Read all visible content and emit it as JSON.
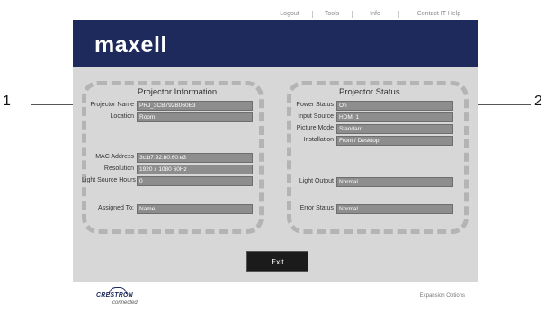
{
  "nav": {
    "logout": "Logout",
    "tools": "Tools",
    "info": "Info",
    "contact": "Contact IT Help"
  },
  "brand": "maxell",
  "projector_info": {
    "title": "Projector Information",
    "name_label": "Projector Name",
    "name": "PRJ_3CB792B060E3",
    "location_label": "Location",
    "location": "Room",
    "mac_label": "MAC Address",
    "mac": "3c:b7:92:b0:60:e3",
    "resolution_label": "Resolution",
    "resolution": "1920 x 1080 60Hz",
    "hours_label": "Light Source Hours",
    "hours": "0",
    "assigned_label": "Assigned To:",
    "assigned": "Name"
  },
  "projector_status": {
    "title": "Projector Status",
    "power_label": "Power Status",
    "power": "On",
    "input_label": "Input Source",
    "input": "HDMI 1",
    "picture_label": "Picture Mode",
    "picture": "Standard",
    "install_label": "Installation",
    "install": "Front / Desktop",
    "light_label": "Light Output",
    "light": "Normal",
    "error_label": "Error Status",
    "error": "Normal"
  },
  "exit_label": "Exit",
  "footer": {
    "crestron": "CRESTRON",
    "connected": "connected",
    "expansion": "Expansion Options"
  },
  "callouts": {
    "left": "1",
    "right": "2"
  }
}
